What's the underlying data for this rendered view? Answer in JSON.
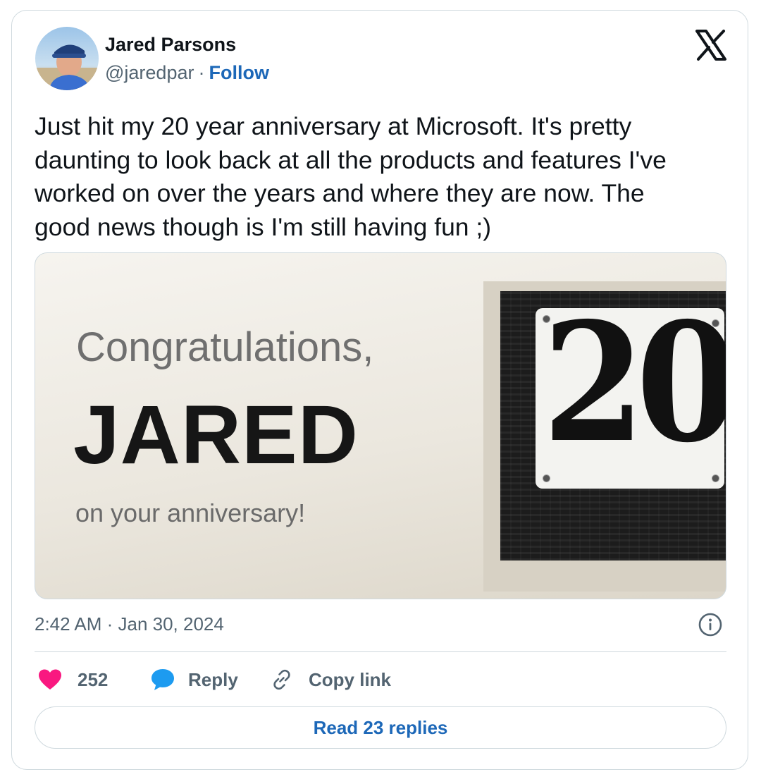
{
  "author": {
    "name": "Jared Parsons",
    "handle": "@jaredpar",
    "separator": "·",
    "follow_label": "Follow"
  },
  "brand_icon": "x-logo-icon",
  "tweet": {
    "text": "Just hit my 20 year anniversary at Microsoft. It's pretty\ndaunting to look back at all the products and features I've\nworked on over the years and where they are now. The\ngood news though is I'm still having fun ;)"
  },
  "media": {
    "congrats": "Congratulations,",
    "name": "JARED",
    "anniversary": "on your anniversary!",
    "plaque_number": "20"
  },
  "meta": {
    "timestamp": "2:42 AM · Jan 30, 2024",
    "info_icon": "info-icon"
  },
  "actions": {
    "like_count": "252",
    "like_icon": "heart-icon",
    "reply_label": "Reply",
    "reply_icon": "speech-bubble-icon",
    "copy_label": "Copy link",
    "copy_icon": "link-icon"
  },
  "read_replies_label": "Read 23 replies",
  "colors": {
    "link_blue": "#1d68b8",
    "heart": "#f91880",
    "reply_bubble": "#1d9bf0",
    "muted_text": "#536471"
  }
}
